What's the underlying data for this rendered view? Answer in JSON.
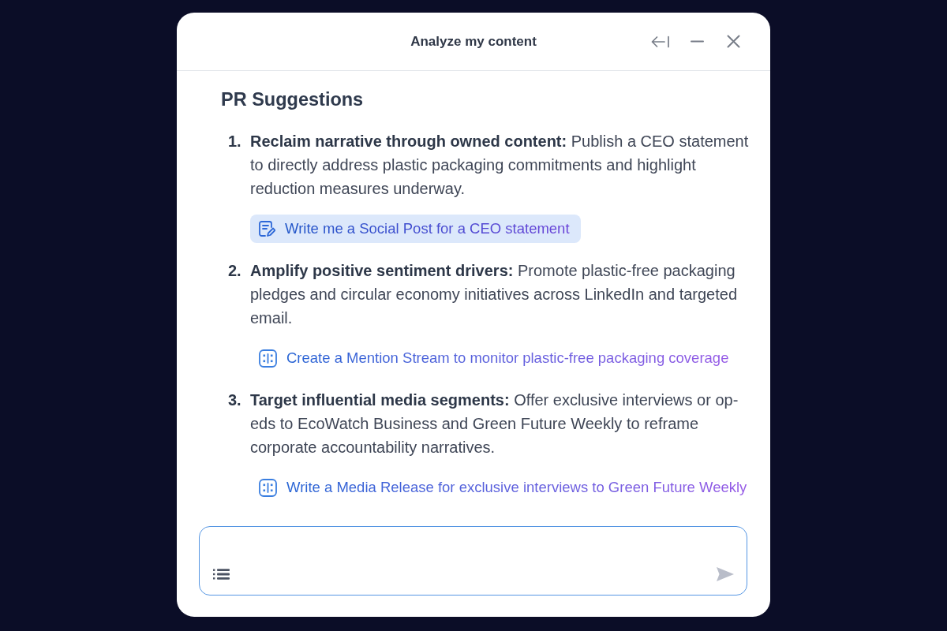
{
  "window": {
    "title": "Analyze my content"
  },
  "suggestions": {
    "heading": "PR Suggestions",
    "items": [
      {
        "number": "1.",
        "text": "**Reclaim narrative through owned content:** Publish a CEO statement to directly address plastic packaging commitments and highlight reduction measures underway.",
        "action": {
          "kind": "edit",
          "label": "Write me a Social Post for a CEO statement",
          "highlighted": true
        }
      },
      {
        "number": "2.",
        "text": "**Amplify positive sentiment drivers:** Promote plastic-free packaging pledges and circular economy initiatives across LinkedIn and targeted email.",
        "action": {
          "kind": "module",
          "label": "Create a Mention Stream to monitor plastic-free packaging coverage",
          "highlighted": false
        }
      },
      {
        "number": "3.",
        "text": "**Target influential media segments:** Offer exclusive interviews or op-eds to EcoWatch Business and Green Future Weekly to reframe corporate accountability narratives.",
        "action": {
          "kind": "module",
          "label": "Write a Media Release for exclusive interviews to Green Future Weekly",
          "highlighted": false
        }
      }
    ]
  },
  "composer": {
    "send_disabled": true
  }
}
